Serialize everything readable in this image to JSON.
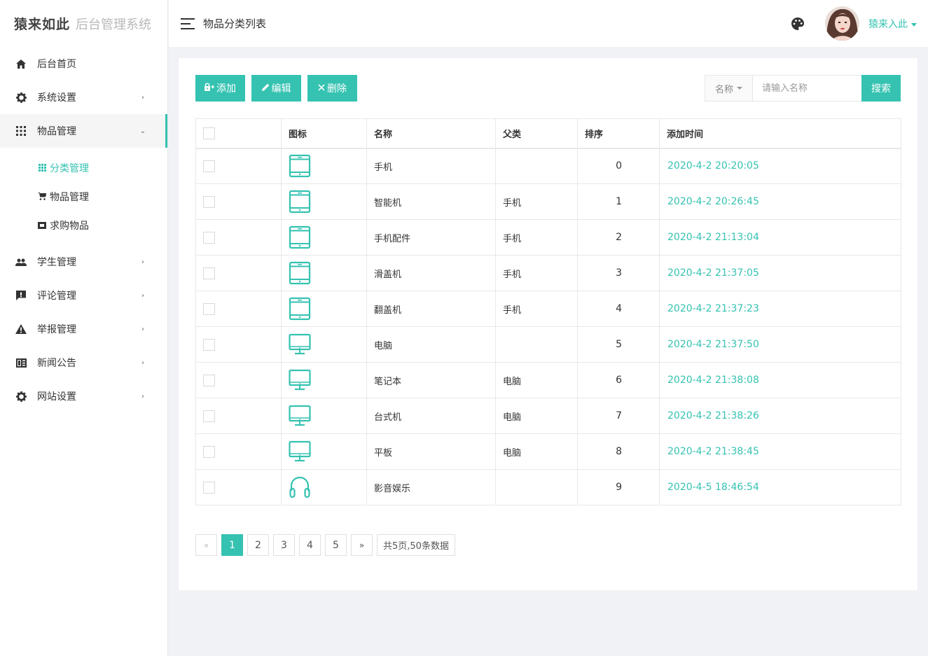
{
  "brand": {
    "name": "猿来如此",
    "system": "后台管理系统"
  },
  "header": {
    "title": "物品分类列表",
    "user_name": "猿来入此"
  },
  "sidebar": {
    "items": [
      {
        "label": "后台首页",
        "icon": "home-icon"
      },
      {
        "label": "系统设置",
        "icon": "gear-icon"
      },
      {
        "label": "物品管理",
        "icon": "grid-icon"
      },
      {
        "label": "学生管理",
        "icon": "people-icon"
      },
      {
        "label": "评论管理",
        "icon": "comment-icon"
      },
      {
        "label": "举报管理",
        "icon": "warning-icon"
      },
      {
        "label": "新闻公告",
        "icon": "news-icon"
      },
      {
        "label": "网站设置",
        "icon": "gear-icon"
      }
    ],
    "submenu": [
      {
        "label": "分类管理",
        "icon": "grid-icon",
        "active": true
      },
      {
        "label": "物品管理",
        "icon": "cart-icon"
      },
      {
        "label": "求购物品",
        "icon": "ticket-icon"
      }
    ]
  },
  "toolbar": {
    "add_label": "添加",
    "edit_label": "编辑",
    "delete_label": "删除"
  },
  "search": {
    "field_label": "名称",
    "placeholder": "请输入名称",
    "button_label": "搜索"
  },
  "table": {
    "headers": [
      "",
      "图标",
      "名称",
      "父类",
      "排序",
      "添加时间"
    ],
    "rows": [
      {
        "icon": "tablet-icon",
        "name": "手机",
        "parent": "",
        "sort": "0",
        "time": "2020-4-2 20:20:05"
      },
      {
        "icon": "tablet-icon",
        "name": "智能机",
        "parent": "手机",
        "sort": "1",
        "time": "2020-4-2 20:26:45"
      },
      {
        "icon": "tablet-icon",
        "name": "手机配件",
        "parent": "手机",
        "sort": "2",
        "time": "2020-4-2 21:13:04"
      },
      {
        "icon": "tablet-icon",
        "name": "滑盖机",
        "parent": "手机",
        "sort": "3",
        "time": "2020-4-2 21:37:05"
      },
      {
        "icon": "tablet-icon",
        "name": "翻盖机",
        "parent": "手机",
        "sort": "4",
        "time": "2020-4-2 21:37:23"
      },
      {
        "icon": "monitor-icon",
        "name": "电脑",
        "parent": "",
        "sort": "5",
        "time": "2020-4-2 21:37:50"
      },
      {
        "icon": "monitor-icon",
        "name": "笔记本",
        "parent": "电脑",
        "sort": "6",
        "time": "2020-4-2 21:38:08"
      },
      {
        "icon": "monitor-icon",
        "name": "台式机",
        "parent": "电脑",
        "sort": "7",
        "time": "2020-4-2 21:38:26"
      },
      {
        "icon": "monitor-icon",
        "name": "平板",
        "parent": "电脑",
        "sort": "8",
        "time": "2020-4-2 21:38:45"
      },
      {
        "icon": "headphones-icon",
        "name": "影音娱乐",
        "parent": "",
        "sort": "9",
        "time": "2020-4-5 18:46:54"
      }
    ]
  },
  "pagination": {
    "prev": "«",
    "next": "»",
    "pages": [
      "1",
      "2",
      "3",
      "4",
      "5"
    ],
    "current": "1",
    "summary": "共5页,50条数据"
  },
  "colors": {
    "accent": "#35c2b1",
    "background": "#f1f2f5"
  }
}
